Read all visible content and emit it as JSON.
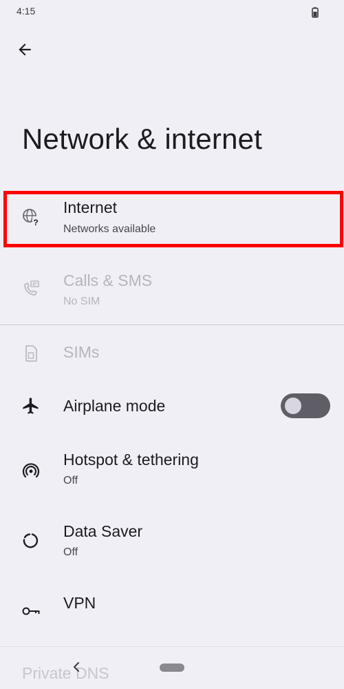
{
  "status_bar": {
    "time": "4:15",
    "battery_icon": "battery-icon"
  },
  "header": {
    "back_icon": "arrow-back-icon",
    "title": "Network & internet"
  },
  "items": [
    {
      "title": "Internet",
      "subtitle": "Networks available",
      "icon": "globe-question-icon",
      "enabled": true,
      "highlighted": true
    },
    {
      "title": "Calls & SMS",
      "subtitle": "No SIM",
      "icon": "phone-message-icon",
      "enabled": false
    },
    {
      "title": "SIMs",
      "subtitle": "",
      "icon": "sim-card-icon",
      "enabled": false
    },
    {
      "title": "Airplane mode",
      "subtitle": "",
      "icon": "airplane-icon",
      "enabled": true,
      "toggle": false
    },
    {
      "title": "Hotspot & tethering",
      "subtitle": "Off",
      "icon": "hotspot-icon",
      "enabled": true
    },
    {
      "title": "Data Saver",
      "subtitle": "Off",
      "icon": "data-saver-icon",
      "enabled": true
    },
    {
      "title": "VPN",
      "subtitle": "",
      "icon": "vpn-key-icon",
      "enabled": true
    },
    {
      "title": "Private DNS",
      "subtitle": "",
      "enabled": true
    }
  ],
  "colors": {
    "background": "#f1eff6",
    "highlight": "#ff0000",
    "toggle_track": "#5f5d66",
    "disabled_text": "#b7b5bc"
  },
  "nav_bar": {
    "back_icon": "nav-back-icon",
    "home_icon": "nav-home-pill"
  }
}
